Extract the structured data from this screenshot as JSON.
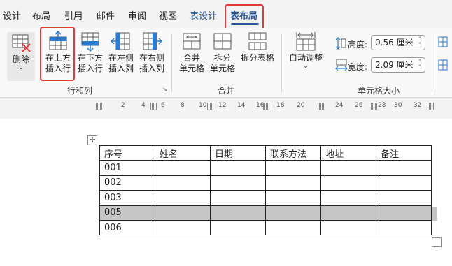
{
  "tabs": [
    {
      "label": "设计"
    },
    {
      "label": "布局"
    },
    {
      "label": "引用"
    },
    {
      "label": "邮件"
    },
    {
      "label": "审阅"
    },
    {
      "label": "视图"
    },
    {
      "label": "表设计"
    },
    {
      "label": "表布局"
    }
  ],
  "ribbon": {
    "delete": {
      "label": "删除",
      "arrow": "⌄"
    },
    "insert_above": {
      "line1": "在上方",
      "line2": "插入行"
    },
    "insert_below": {
      "line1": "在下方",
      "line2": "插入行"
    },
    "insert_left": {
      "line1": "在左侧",
      "line2": "插入列"
    },
    "insert_right": {
      "line1": "在右侧",
      "line2": "插入列"
    },
    "group_rows_cols": "行和列",
    "merge_cells": {
      "line1": "合并",
      "line2": "单元格"
    },
    "split_cells": {
      "line1": "拆分",
      "line2": "单元格"
    },
    "split_table": {
      "line1": "拆分表格"
    },
    "group_merge": "合并",
    "autofit": {
      "line1": "自动调整",
      "arrow": "⌄"
    },
    "height_label": "高度:",
    "height_value": "0.56 厘米",
    "width_label": "宽度:",
    "width_value": "2.09 厘米",
    "group_cell_size": "单元格大小",
    "launcher": "↘"
  },
  "ruler": {
    "numbers": [
      "2",
      "4",
      "6",
      "8",
      "10",
      "12",
      "14",
      "16",
      "18",
      "20",
      "24",
      "26",
      "28",
      "30",
      "32"
    ]
  },
  "document": {
    "move_handle": "✢",
    "table": {
      "headers": [
        "序号",
        "姓名",
        "日期",
        "联系方法",
        "地址",
        "备注"
      ],
      "rows": [
        [
          "001",
          "",
          "",
          "",
          "",
          ""
        ],
        [
          "002",
          "",
          "",
          "",
          "",
          ""
        ],
        [
          "003",
          "",
          "",
          "",
          "",
          ""
        ],
        [
          "005",
          "",
          "",
          "",
          "",
          ""
        ],
        [
          "006",
          "",
          "",
          "",
          "",
          ""
        ]
      ],
      "selected_row_index": 3
    }
  },
  "colors": {
    "accent": "#2b579a",
    "highlight_border": "#e03a3a",
    "selected_row": "#c6c6c6"
  }
}
